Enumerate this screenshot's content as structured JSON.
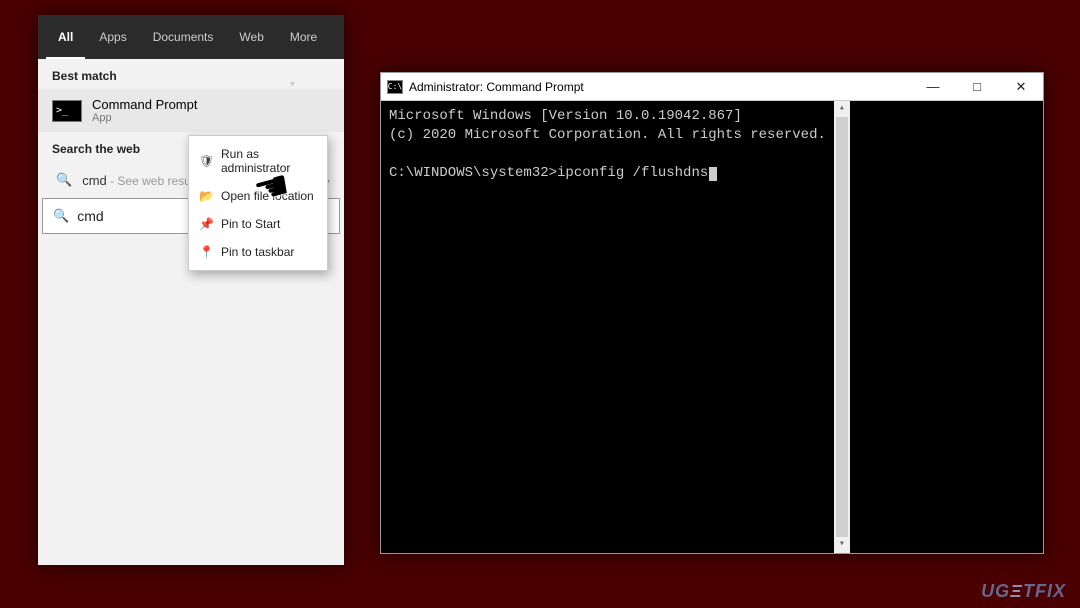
{
  "search_panel": {
    "tabs": [
      "All",
      "Apps",
      "Documents",
      "Web",
      "More"
    ],
    "active_tab_index": 0,
    "best_match_label": "Best match",
    "result": {
      "title": "Command Prompt",
      "subtitle": "App"
    },
    "search_web_label": "Search the web",
    "web_result": {
      "query": "cmd",
      "suffix": " - See web results"
    }
  },
  "context_menu": {
    "items": [
      {
        "icon": "admin-icon",
        "glyph": "🛡",
        "label": "Run as administrator"
      },
      {
        "icon": "folder-icon",
        "glyph": "📂",
        "label": "Open file location"
      },
      {
        "icon": "pin-start-icon",
        "glyph": "📌",
        "label": "Pin to Start"
      },
      {
        "icon": "pin-taskbar-icon",
        "glyph": "📍",
        "label": "Pin to taskbar"
      }
    ]
  },
  "searchbox": {
    "value": "cmd"
  },
  "cmd_window": {
    "title": "Administrator: Command Prompt",
    "lines": [
      "Microsoft Windows [Version 10.0.19042.867]",
      "(c) 2020 Microsoft Corporation. All rights reserved.",
      "",
      "C:\\WINDOWS\\system32>ipconfig /flushdns"
    ]
  },
  "watermark": "UGETFIX"
}
